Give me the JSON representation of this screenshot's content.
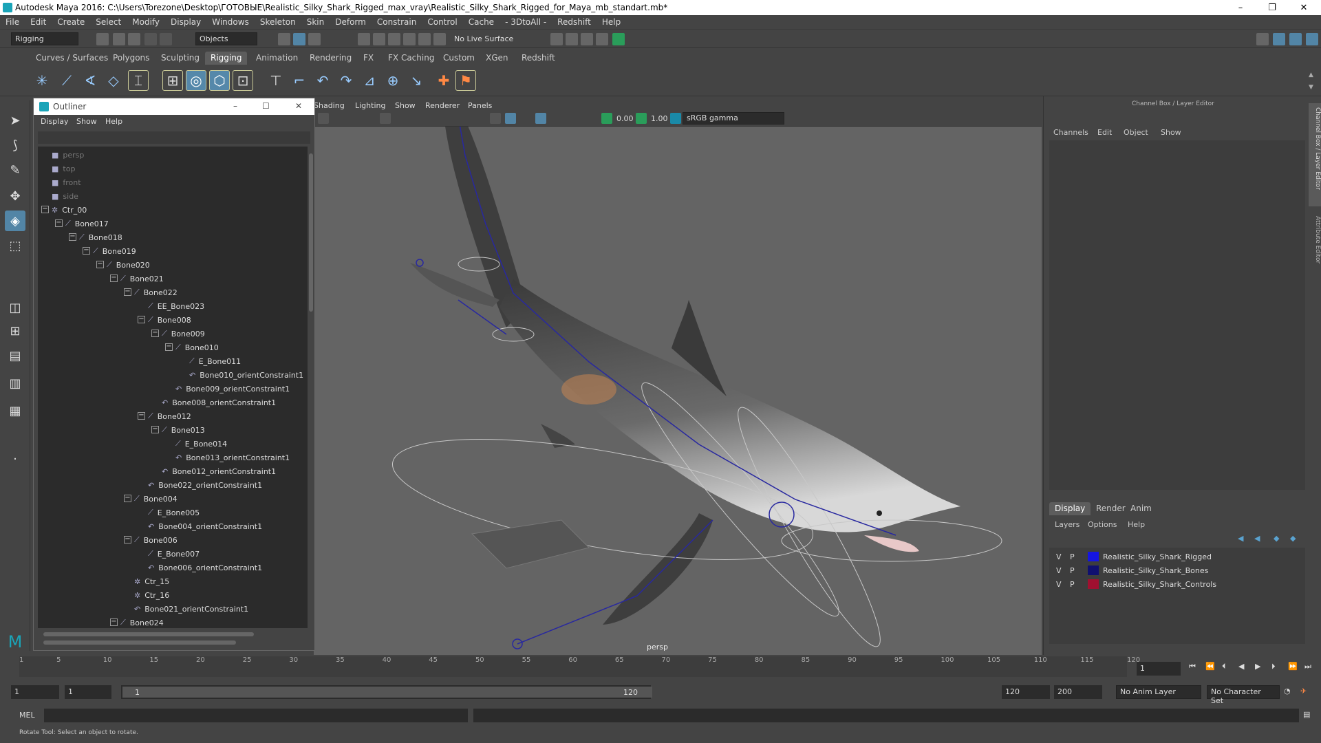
{
  "window": {
    "title": "Autodesk Maya 2016: C:\\Users\\Torezone\\Desktop\\ГОТОВЫЕ\\Realistic_Silky_Shark_Rigged_max_vray\\Realistic_Silky_Shark_Rigged_for_Maya_mb_standart.mb*",
    "minimize": "–",
    "restore": "❐",
    "close": "✕"
  },
  "menubar": [
    "File",
    "Edit",
    "Create",
    "Select",
    "Modify",
    "Display",
    "Windows",
    "Skeleton",
    "Skin",
    "Deform",
    "Constrain",
    "Control",
    "Cache",
    "- 3DtoAll -",
    "Redshift",
    "Help"
  ],
  "status": {
    "menuset": "Rigging",
    "objects": "Objects",
    "live_surface": "No Live Surface"
  },
  "shelf_tabs": [
    "Curves / Surfaces",
    "Polygons",
    "Sculpting",
    "Rigging",
    "Animation",
    "Rendering",
    "FX",
    "FX Caching",
    "Custom",
    "XGen",
    "Redshift"
  ],
  "active_shelf": "Rigging",
  "outliner": {
    "title": "Outliner",
    "menu": [
      "Display",
      "Show",
      "Help"
    ],
    "rows": [
      {
        "label": "persp",
        "indent": 0,
        "dim": true,
        "type": "cam"
      },
      {
        "label": "top",
        "indent": 0,
        "dim": true,
        "type": "cam"
      },
      {
        "label": "front",
        "indent": 0,
        "dim": true,
        "type": "cam"
      },
      {
        "label": "side",
        "indent": 0,
        "dim": true,
        "type": "cam"
      },
      {
        "label": "Ctr_00",
        "indent": 0,
        "exp": true,
        "type": "ctr"
      },
      {
        "label": "Bone017",
        "indent": 1,
        "exp": true,
        "type": "bone"
      },
      {
        "label": "Bone018",
        "indent": 2,
        "exp": true,
        "type": "bone"
      },
      {
        "label": "Bone019",
        "indent": 3,
        "exp": true,
        "type": "bone"
      },
      {
        "label": "Bone020",
        "indent": 4,
        "exp": true,
        "type": "bone"
      },
      {
        "label": "Bone021",
        "indent": 5,
        "exp": true,
        "type": "bone"
      },
      {
        "label": "Bone022",
        "indent": 6,
        "exp": true,
        "type": "bone"
      },
      {
        "label": "EE_Bone023",
        "indent": 7,
        "type": "bone"
      },
      {
        "label": "Bone008",
        "indent": 7,
        "exp": true,
        "type": "bone"
      },
      {
        "label": "Bone009",
        "indent": 8,
        "exp": true,
        "type": "bone"
      },
      {
        "label": "Bone010",
        "indent": 9,
        "exp": true,
        "type": "bone"
      },
      {
        "label": "E_Bone011",
        "indent": 10,
        "type": "bone"
      },
      {
        "label": "Bone010_orientConstraint1",
        "indent": 10,
        "type": "con"
      },
      {
        "label": "Bone009_orientConstraint1",
        "indent": 9,
        "type": "con"
      },
      {
        "label": "Bone008_orientConstraint1",
        "indent": 8,
        "type": "con"
      },
      {
        "label": "Bone012",
        "indent": 7,
        "exp": true,
        "type": "bone"
      },
      {
        "label": "Bone013",
        "indent": 8,
        "exp": true,
        "type": "bone"
      },
      {
        "label": "E_Bone014",
        "indent": 9,
        "type": "bone"
      },
      {
        "label": "Bone013_orientConstraint1",
        "indent": 9,
        "type": "con"
      },
      {
        "label": "Bone012_orientConstraint1",
        "indent": 8,
        "type": "con"
      },
      {
        "label": "Bone022_orientConstraint1",
        "indent": 7,
        "type": "con"
      },
      {
        "label": "Bone004",
        "indent": 6,
        "exp": true,
        "type": "bone"
      },
      {
        "label": "E_Bone005",
        "indent": 7,
        "type": "bone"
      },
      {
        "label": "Bone004_orientConstraint1",
        "indent": 7,
        "type": "con"
      },
      {
        "label": "Bone006",
        "indent": 6,
        "exp": true,
        "type": "bone"
      },
      {
        "label": "E_Bone007",
        "indent": 7,
        "type": "bone"
      },
      {
        "label": "Bone006_orientConstraint1",
        "indent": 7,
        "type": "con"
      },
      {
        "label": "Ctr_15",
        "indent": 6,
        "type": "ctr"
      },
      {
        "label": "Ctr_16",
        "indent": 6,
        "type": "ctr"
      },
      {
        "label": "Bone021_orientConstraint1",
        "indent": 6,
        "type": "con"
      },
      {
        "label": "Bone024",
        "indent": 5,
        "exp": true,
        "type": "bone"
      }
    ]
  },
  "viewport": {
    "menu": [
      "Shading",
      "Lighting",
      "Show",
      "Renderer",
      "Panels"
    ],
    "field1": "0.00",
    "field2": "1.00",
    "colorspace": "sRGB gamma",
    "camera": "persp"
  },
  "channelbox": {
    "title": "Channel Box / Layer Editor",
    "menu": [
      "Channels",
      "Edit",
      "Object",
      "Show"
    ],
    "tabs": [
      "Display",
      "Render",
      "Anim"
    ],
    "active_tab": "Display",
    "layer_menu": [
      "Layers",
      "Options",
      "Help"
    ],
    "layers": [
      {
        "v": "V",
        "p": "P",
        "name": "Realistic_Silky_Shark_Rigged",
        "color": "#1515e0"
      },
      {
        "v": "V",
        "p": "P",
        "name": "Realistic_Silky_Shark_Bones",
        "color": "#101070"
      },
      {
        "v": "V",
        "p": "P",
        "name": "Realistic_Silky_Shark_Controls",
        "color": "#a01030"
      }
    ]
  },
  "side_tabs": [
    "Channel Box / Layer Editor",
    "Attribute Editor"
  ],
  "timeline": {
    "ticks": [
      "1",
      "5",
      "10",
      "15",
      "20",
      "25",
      "30",
      "35",
      "40",
      "45",
      "50",
      "55",
      "60",
      "65",
      "70",
      "75",
      "80",
      "85",
      "90",
      "95",
      "100",
      "105",
      "110",
      "115",
      "120"
    ],
    "current": "1"
  },
  "range": {
    "start": "1",
    "playback_start": "1",
    "slider_start": "1",
    "slider_end": "120",
    "playback_end": "120",
    "end": "200",
    "anim_layer": "No Anim Layer",
    "char_set": "No Character Set"
  },
  "mel": {
    "label": "MEL"
  },
  "help": "Rotate Tool: Select an object to rotate.",
  "colors": {
    "accent": "#5285a6",
    "active_tab": "#5d5d5d"
  }
}
